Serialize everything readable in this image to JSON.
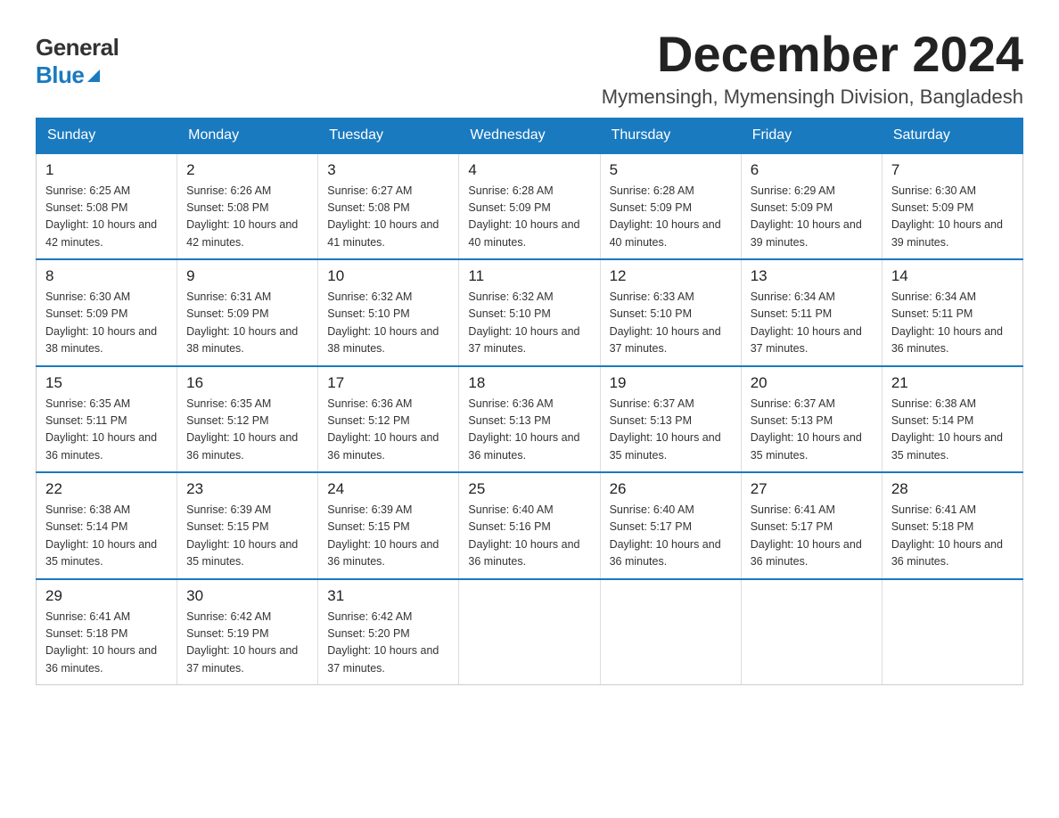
{
  "logo": {
    "general": "General",
    "blue": "Blue"
  },
  "title": "December 2024",
  "location": "Mymensingh, Mymensingh Division, Bangladesh",
  "days_of_week": [
    "Sunday",
    "Monday",
    "Tuesday",
    "Wednesday",
    "Thursday",
    "Friday",
    "Saturday"
  ],
  "weeks": [
    [
      {
        "day": "1",
        "sunrise": "6:25 AM",
        "sunset": "5:08 PM",
        "daylight": "10 hours and 42 minutes."
      },
      {
        "day": "2",
        "sunrise": "6:26 AM",
        "sunset": "5:08 PM",
        "daylight": "10 hours and 42 minutes."
      },
      {
        "day": "3",
        "sunrise": "6:27 AM",
        "sunset": "5:08 PM",
        "daylight": "10 hours and 41 minutes."
      },
      {
        "day": "4",
        "sunrise": "6:28 AM",
        "sunset": "5:09 PM",
        "daylight": "10 hours and 40 minutes."
      },
      {
        "day": "5",
        "sunrise": "6:28 AM",
        "sunset": "5:09 PM",
        "daylight": "10 hours and 40 minutes."
      },
      {
        "day": "6",
        "sunrise": "6:29 AM",
        "sunset": "5:09 PM",
        "daylight": "10 hours and 39 minutes."
      },
      {
        "day": "7",
        "sunrise": "6:30 AM",
        "sunset": "5:09 PM",
        "daylight": "10 hours and 39 minutes."
      }
    ],
    [
      {
        "day": "8",
        "sunrise": "6:30 AM",
        "sunset": "5:09 PM",
        "daylight": "10 hours and 38 minutes."
      },
      {
        "day": "9",
        "sunrise": "6:31 AM",
        "sunset": "5:09 PM",
        "daylight": "10 hours and 38 minutes."
      },
      {
        "day": "10",
        "sunrise": "6:32 AM",
        "sunset": "5:10 PM",
        "daylight": "10 hours and 38 minutes."
      },
      {
        "day": "11",
        "sunrise": "6:32 AM",
        "sunset": "5:10 PM",
        "daylight": "10 hours and 37 minutes."
      },
      {
        "day": "12",
        "sunrise": "6:33 AM",
        "sunset": "5:10 PM",
        "daylight": "10 hours and 37 minutes."
      },
      {
        "day": "13",
        "sunrise": "6:34 AM",
        "sunset": "5:11 PM",
        "daylight": "10 hours and 37 minutes."
      },
      {
        "day": "14",
        "sunrise": "6:34 AM",
        "sunset": "5:11 PM",
        "daylight": "10 hours and 36 minutes."
      }
    ],
    [
      {
        "day": "15",
        "sunrise": "6:35 AM",
        "sunset": "5:11 PM",
        "daylight": "10 hours and 36 minutes."
      },
      {
        "day": "16",
        "sunrise": "6:35 AM",
        "sunset": "5:12 PM",
        "daylight": "10 hours and 36 minutes."
      },
      {
        "day": "17",
        "sunrise": "6:36 AM",
        "sunset": "5:12 PM",
        "daylight": "10 hours and 36 minutes."
      },
      {
        "day": "18",
        "sunrise": "6:36 AM",
        "sunset": "5:13 PM",
        "daylight": "10 hours and 36 minutes."
      },
      {
        "day": "19",
        "sunrise": "6:37 AM",
        "sunset": "5:13 PM",
        "daylight": "10 hours and 35 minutes."
      },
      {
        "day": "20",
        "sunrise": "6:37 AM",
        "sunset": "5:13 PM",
        "daylight": "10 hours and 35 minutes."
      },
      {
        "day": "21",
        "sunrise": "6:38 AM",
        "sunset": "5:14 PM",
        "daylight": "10 hours and 35 minutes."
      }
    ],
    [
      {
        "day": "22",
        "sunrise": "6:38 AM",
        "sunset": "5:14 PM",
        "daylight": "10 hours and 35 minutes."
      },
      {
        "day": "23",
        "sunrise": "6:39 AM",
        "sunset": "5:15 PM",
        "daylight": "10 hours and 35 minutes."
      },
      {
        "day": "24",
        "sunrise": "6:39 AM",
        "sunset": "5:15 PM",
        "daylight": "10 hours and 36 minutes."
      },
      {
        "day": "25",
        "sunrise": "6:40 AM",
        "sunset": "5:16 PM",
        "daylight": "10 hours and 36 minutes."
      },
      {
        "day": "26",
        "sunrise": "6:40 AM",
        "sunset": "5:17 PM",
        "daylight": "10 hours and 36 minutes."
      },
      {
        "day": "27",
        "sunrise": "6:41 AM",
        "sunset": "5:17 PM",
        "daylight": "10 hours and 36 minutes."
      },
      {
        "day": "28",
        "sunrise": "6:41 AM",
        "sunset": "5:18 PM",
        "daylight": "10 hours and 36 minutes."
      }
    ],
    [
      {
        "day": "29",
        "sunrise": "6:41 AM",
        "sunset": "5:18 PM",
        "daylight": "10 hours and 36 minutes."
      },
      {
        "day": "30",
        "sunrise": "6:42 AM",
        "sunset": "5:19 PM",
        "daylight": "10 hours and 37 minutes."
      },
      {
        "day": "31",
        "sunrise": "6:42 AM",
        "sunset": "5:20 PM",
        "daylight": "10 hours and 37 minutes."
      },
      null,
      null,
      null,
      null
    ]
  ]
}
